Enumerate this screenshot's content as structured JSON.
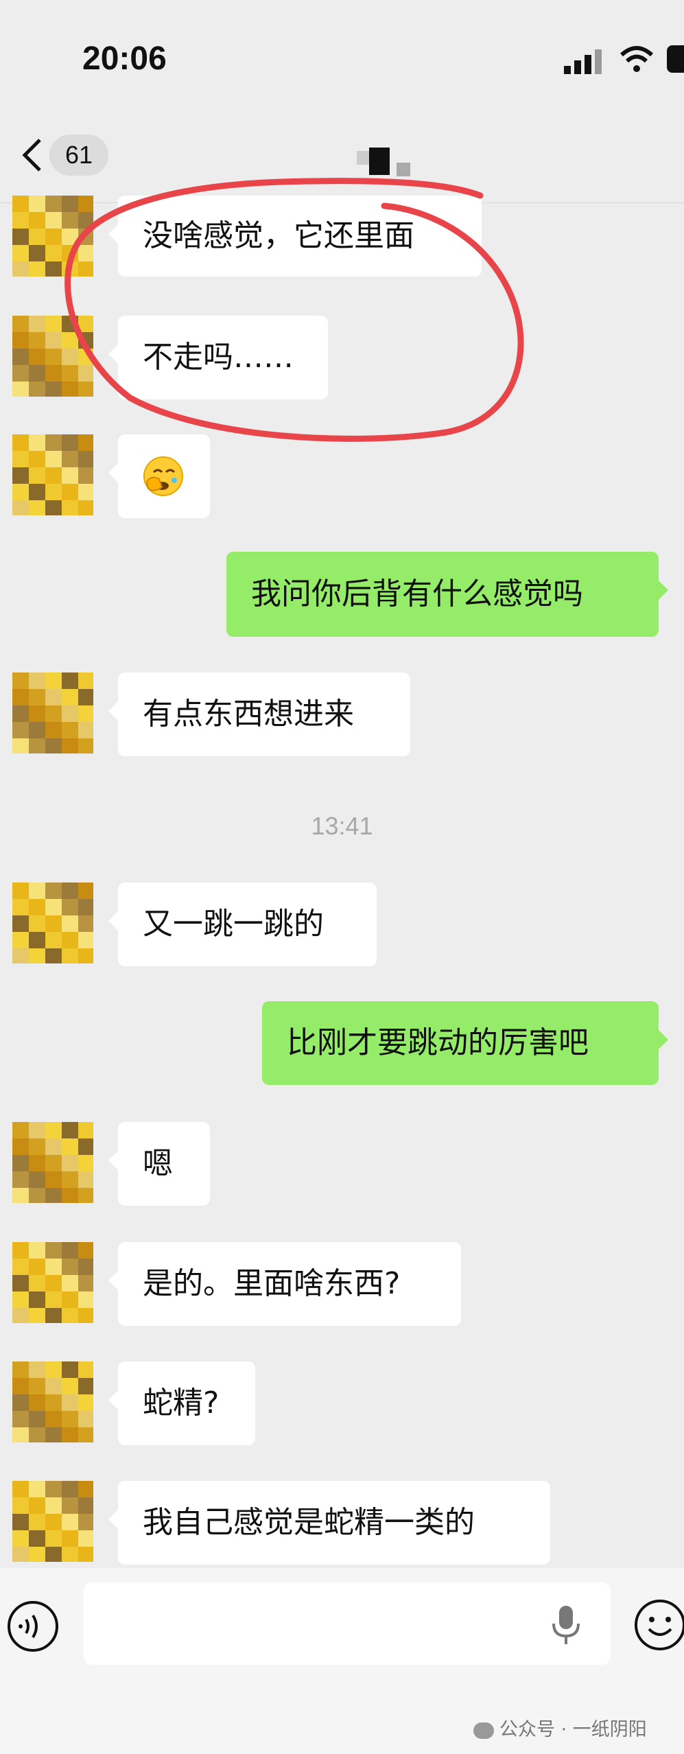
{
  "status_bar": {
    "time": "20:06"
  },
  "navbar": {
    "unread_count": "61"
  },
  "timestamp": "13:41",
  "messages": [
    {
      "side": "left",
      "text": "没啥感觉，它还里面"
    },
    {
      "side": "left",
      "text": "不走吗……"
    },
    {
      "side": "left",
      "text": "",
      "emoji": "face-palm-emoji"
    },
    {
      "side": "right",
      "text": "我问你后背有什么感觉吗"
    },
    {
      "side": "left",
      "text": "有点东西想进来"
    },
    {
      "side": "left",
      "text": "又一跳一跳的"
    },
    {
      "side": "right",
      "text": "比刚才要跳动的厉害吧"
    },
    {
      "side": "left",
      "text": "嗯"
    },
    {
      "side": "left",
      "text": "是的。里面啥东西?"
    },
    {
      "side": "left",
      "text": "蛇精?"
    },
    {
      "side": "left",
      "text": "我自己感觉是蛇精一类的"
    }
  ],
  "watermark": "公众号 · 一纸阴阳",
  "colors": {
    "sent_bubble": "#95ec69",
    "received_bubble": "#ffffff",
    "annotation": "#e8454a"
  }
}
